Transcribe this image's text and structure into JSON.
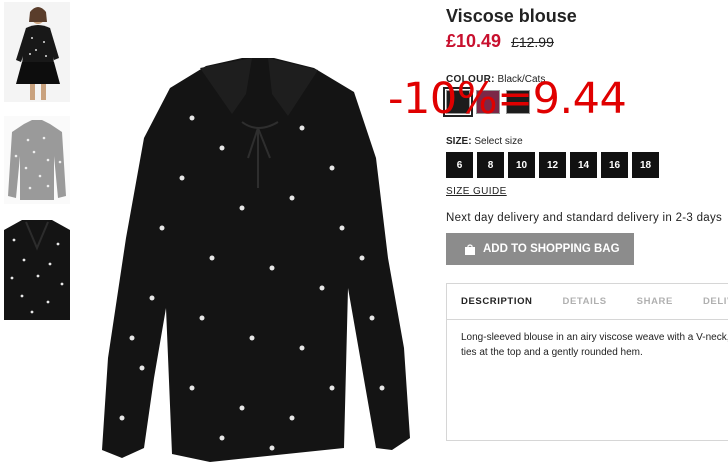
{
  "product": {
    "title": "Viscose blouse",
    "price_now": "£10.49",
    "price_old": "£12.99"
  },
  "overlay": {
    "discount_text": "-10%=9.44"
  },
  "colour": {
    "label": "COLOUR:",
    "value": "Black/Cats"
  },
  "size": {
    "label": "SIZE:",
    "value": "Select size",
    "options": [
      "6",
      "8",
      "10",
      "12",
      "14",
      "16",
      "18"
    ],
    "guide": "SIZE GUIDE"
  },
  "delivery": {
    "text": "Next day delivery and standard delivery in 2-3 days"
  },
  "cart": {
    "add_label": "ADD TO SHOPPING BAG"
  },
  "tabs": [
    {
      "label": "DESCRIPTION"
    },
    {
      "label": "DETAILS"
    },
    {
      "label": "SHARE"
    },
    {
      "label": "DELIVERY"
    }
  ],
  "description": {
    "line1": "Long-sleeved blouse in an airy viscose weave with a V-neck,",
    "line2": "ties at the top and a gently rounded hem."
  },
  "colors": {
    "price_sale": "#c8102e",
    "button_bg": "#8c8c8c",
    "size_bg": "#111111",
    "blouse": "#141414",
    "overlay": "#e00000"
  },
  "icons": [
    "shopping-bag-icon"
  ]
}
